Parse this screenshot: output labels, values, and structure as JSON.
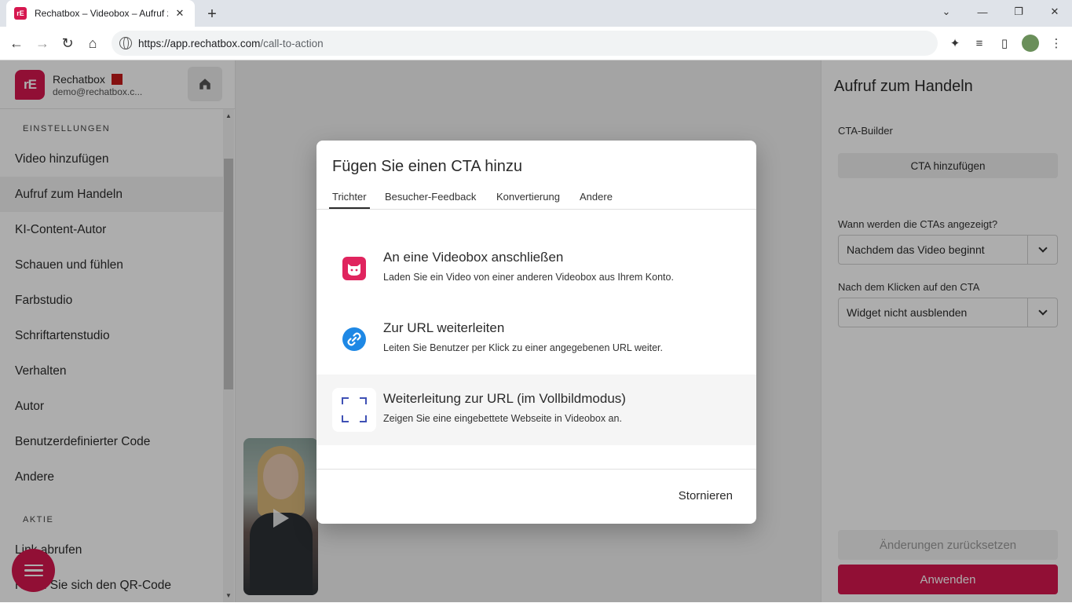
{
  "browser": {
    "tab_title": "Rechatbox – Videobox – Aufruf z",
    "favicon_text": "rE",
    "url_host": "https://app.rechatbox.com",
    "url_path": "/call-to-action"
  },
  "sidebar": {
    "brand_name": "Rechatbox",
    "brand_email": "demo@rechatbox.c...",
    "sections": {
      "settings": "EINSTELLUNGEN",
      "active": "AKTIE"
    },
    "items": [
      {
        "label": "Video hinzufügen"
      },
      {
        "label": "Aufruf zum Handeln"
      },
      {
        "label": "KI-Content-Autor"
      },
      {
        "label": "Schauen und fühlen"
      },
      {
        "label": "Farbstudio"
      },
      {
        "label": "Schriftartenstudio"
      },
      {
        "label": "Verhalten"
      },
      {
        "label": "Autor"
      },
      {
        "label": "Benutzerdefinierter Code"
      },
      {
        "label": "Andere"
      }
    ],
    "active_items": [
      {
        "label": "Link abrufen"
      },
      {
        "label": "Holen Sie sich den QR-Code"
      }
    ]
  },
  "right_panel": {
    "title": "Aufruf zum Handeln",
    "builder_label": "CTA-Builder",
    "add_cta_label": "CTA hinzufügen",
    "when_label": "Wann werden die CTAs angezeigt?",
    "when_value": "Nachdem das Video beginnt",
    "after_click_label": "Nach dem Klicken auf den CTA",
    "after_click_value": "Widget nicht ausblenden",
    "reset_label": "Änderungen zurücksetzen",
    "apply_label": "Anwenden"
  },
  "modal": {
    "title": "Fügen Sie einen CTA hinzu",
    "tabs": [
      {
        "label": "Trichter"
      },
      {
        "label": "Besucher-Feedback"
      },
      {
        "label": "Konvertierung"
      },
      {
        "label": "Andere"
      }
    ],
    "options": [
      {
        "title": "An eine Videobox anschließen",
        "description": "Laden Sie ein Video von einer anderen Videobox aus Ihrem Konto.",
        "icon": "videobox-icon"
      },
      {
        "title": "Zur URL weiterleiten",
        "description": "Leiten Sie Benutzer per Klick zu einer angegebenen URL weiter.",
        "icon": "link-icon"
      },
      {
        "title": "Weiterleitung zur URL (im Vollbildmodus)",
        "description": "Zeigen Sie eine eingebettete Webseite in Videobox an.",
        "icon": "fullscreen-icon"
      }
    ],
    "cancel_label": "Stornieren"
  },
  "colors": {
    "brand": "#d6174f",
    "link_icon": "#1e88e5",
    "fullscreen_icon": "#3f51b5"
  }
}
